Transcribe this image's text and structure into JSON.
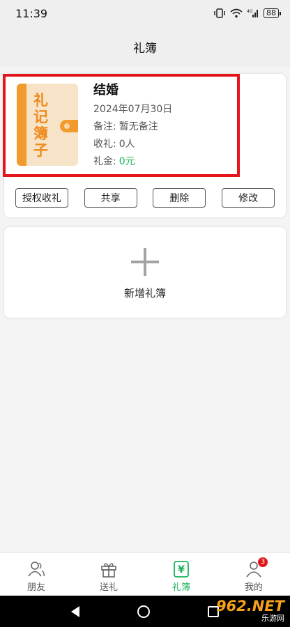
{
  "status_bar": {
    "time": "11:39",
    "battery": "88",
    "icons": [
      "vibrate-icon",
      "wifi-icon",
      "signal-4g-icon",
      "battery-icon"
    ]
  },
  "header": {
    "title": "礼簿"
  },
  "book": {
    "cover_text": "礼记簿子",
    "title": "结婚",
    "date": "2024年07月30日",
    "note_label": "备注:",
    "note_value": "暂无备注",
    "received_label": "收礼:",
    "received_value": "0人",
    "money_label": "礼金:",
    "money_value": "0元"
  },
  "actions": {
    "authorize": "授权收礼",
    "share": "共享",
    "delete": "删除",
    "edit": "修改"
  },
  "add_book": {
    "label": "新增礼簿"
  },
  "tabs": [
    {
      "label": "朋友",
      "icon": "friends-icon",
      "active": false
    },
    {
      "label": "送礼",
      "icon": "gift-icon",
      "active": false
    },
    {
      "label": "礼簿",
      "icon": "ledger-yen-icon",
      "active": true
    },
    {
      "label": "我的",
      "icon": "profile-icon",
      "active": false,
      "badge": "3"
    }
  ],
  "watermark": {
    "main": "962.NET",
    "sub": "乐游网"
  },
  "colors": {
    "accent_green": "#19b35a",
    "highlight_red": "#e4141b",
    "book_orange": "#f29a2e"
  }
}
